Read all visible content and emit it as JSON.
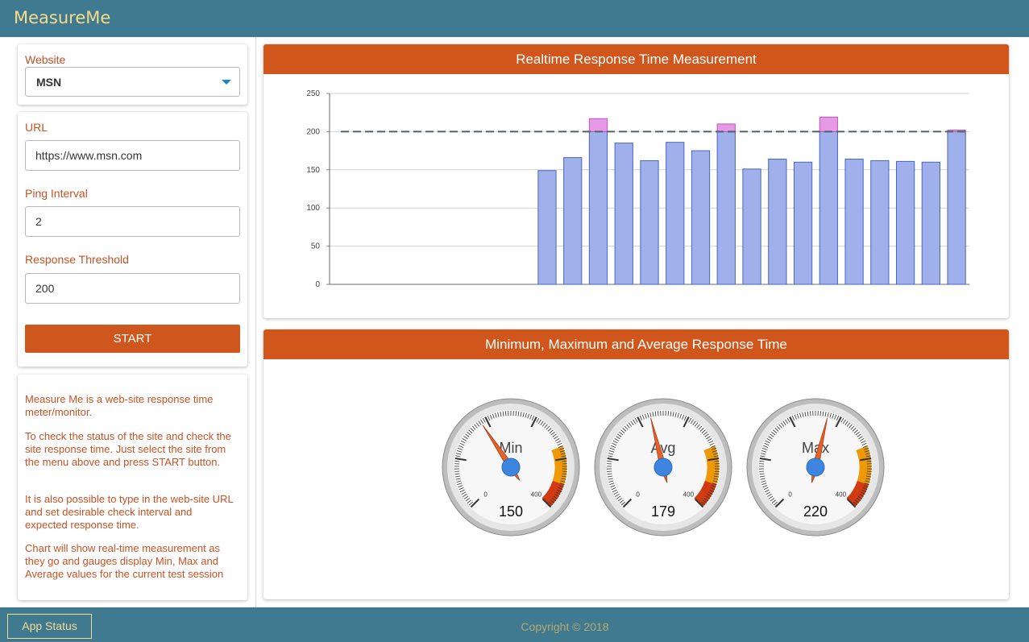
{
  "header": {
    "title": "MeasureMe"
  },
  "sidebar": {
    "website_label": "Website",
    "website_value": "MSN",
    "url_label": "URL",
    "url_value": "https://www.msn.com",
    "ping_label": "Ping Interval",
    "ping_value": "2",
    "threshold_label": "Response Threshold",
    "threshold_value": "200",
    "start_label": "START",
    "info": [
      "Measure Me is a web-site response time meter/monitor.",
      "To check the status of the site and check the site response time. Just select the site from the menu above and press START button.",
      "It is also possible to type in the web-site URL and set desirable check interval and expected response time.",
      "Chart will show real-time measurement as they go and gauges display Min, Max and Average values for the current test session"
    ]
  },
  "realtime": {
    "title": "Realtime Response Time Measurement"
  },
  "gauges_panel": {
    "title": "Minimum, Maximum and Average Response Time",
    "gauges": [
      {
        "label": "Min",
        "value": 150,
        "display": "150"
      },
      {
        "label": "Avg",
        "value": 179,
        "display": "179"
      },
      {
        "label": "Max",
        "value": 220,
        "display": "220"
      }
    ],
    "scale_min": "0",
    "scale_max": "400"
  },
  "footer": {
    "app_status_label": "App Status",
    "copyright": "Copyright © 2018"
  },
  "colors": {
    "bar_fill": "#9fb0ea",
    "bar_stroke": "#4a63c8",
    "over_fill": "#e59ae5",
    "over_stroke": "#c452c4",
    "threshold_line": "#555e6a",
    "accent": "#cf561d",
    "brand_bar": "#3f7a90"
  },
  "chart_data": {
    "type": "bar",
    "title": "Realtime Response Time Measurement",
    "ylim": [
      0,
      250
    ],
    "yticks": [
      "0",
      "50",
      "100",
      "150",
      "200",
      "250"
    ],
    "threshold": 200,
    "slots": 25,
    "values": [
      null,
      null,
      null,
      null,
      null,
      null,
      null,
      null,
      149,
      166,
      217,
      185,
      162,
      186,
      175,
      210,
      151,
      164,
      160,
      219,
      164,
      162,
      161,
      160,
      202
    ]
  }
}
